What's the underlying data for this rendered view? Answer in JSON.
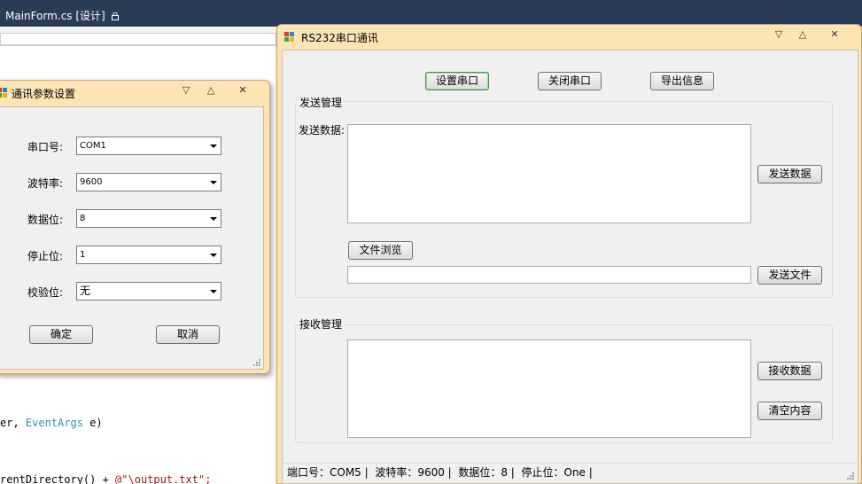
{
  "ide": {
    "tab_label": "MainForm.cs [设计]",
    "code_line_1_ident": "er, ",
    "code_line_1_type": "EventArgs",
    "code_line_1_rest": " e)",
    "code_line_2_ident": "rentDirectory() + ",
    "code_line_2_str": "@\"\\output.txt\";"
  },
  "settings_dialog": {
    "title": "通讯参数设置",
    "port_label": "串口号:",
    "port_value": "COM1",
    "baud_label": "波特率:",
    "baud_value": "9600",
    "databits_label": "数据位:",
    "databits_value": "8",
    "stopbits_label": "停止位:",
    "stopbits_value": "1",
    "parity_label": "校验位:",
    "parity_value": "无",
    "ok_label": "确定",
    "cancel_label": "取消"
  },
  "main_window": {
    "title": "RS232串口通讯",
    "toolbar": {
      "setup_label": "设置串口",
      "close_label": "关闭串口",
      "export_label": "导出信息"
    },
    "send_group": {
      "title": "发送管理",
      "data_label": "发送数据:",
      "send_data_label": "发送数据",
      "browse_label": "文件浏览",
      "send_file_label": "发送文件",
      "file_path": ""
    },
    "receive_group": {
      "title": "接收管理",
      "receive_label": "接收数据",
      "clear_label": "清空内容"
    },
    "status": {
      "port": "端口号：COM5 |",
      "baud": "波特率：9600 |",
      "databits": "数据位：8 |",
      "stopbits": "停止位：One |"
    }
  },
  "colors": {
    "window_frame": "#fce4b4",
    "ide_tab": "#2b3c59",
    "focus_border": "#3c9a3c"
  }
}
